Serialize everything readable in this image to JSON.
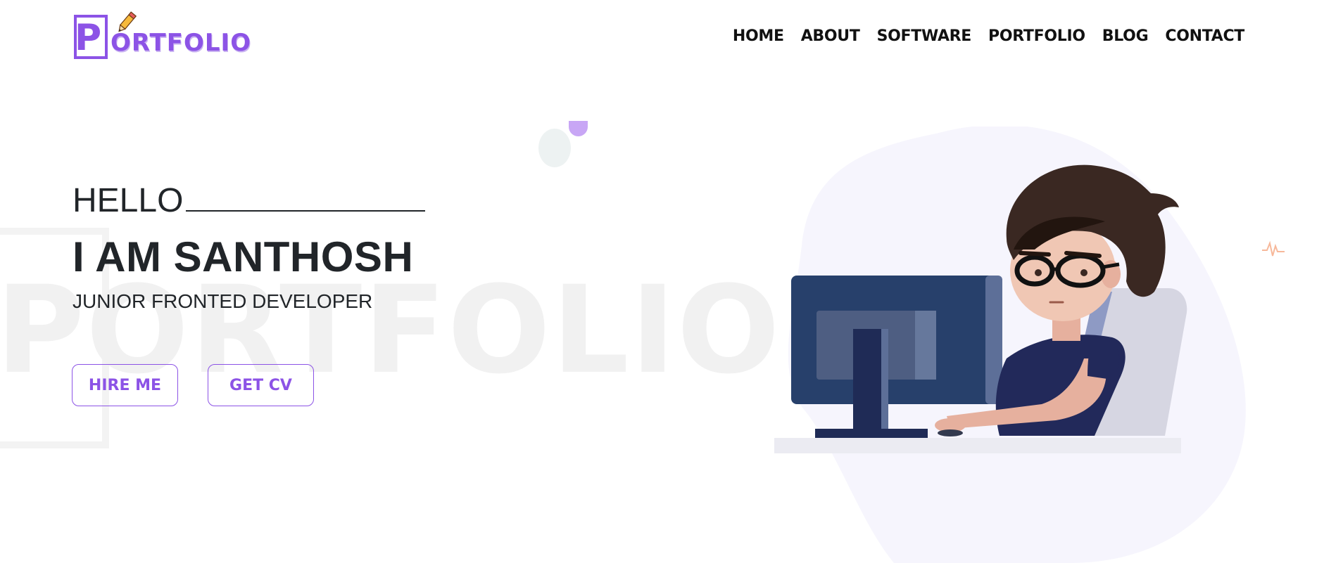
{
  "header": {
    "logo": {
      "first_letter": "P",
      "rest": "ORTFOLIO"
    },
    "nav": [
      "HOME",
      "ABOUT",
      "SOFTWARE",
      "PORTFOLIO",
      "BLOG",
      "CONTACT"
    ]
  },
  "hero": {
    "greeting": "HELLO",
    "name": "I AM SANTHOSH",
    "role": "JUNIOR FRONTED DEVELOPER",
    "watermark": "PORTFOLIO",
    "buttons": {
      "hire": "HIRE ME",
      "cv": "GET CV"
    }
  },
  "colors": {
    "accent": "#8c53e6",
    "text": "#212529",
    "blob": "#f6f5fd"
  },
  "icons": [
    "pencil-icon",
    "pulse-icon"
  ]
}
